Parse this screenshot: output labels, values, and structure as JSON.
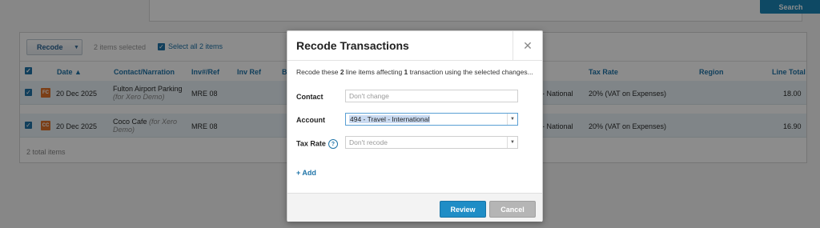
{
  "search": {
    "button_label": "Search"
  },
  "toolbar": {
    "recode_label": "Recode",
    "items_selected": "2 items selected",
    "select_all": "Select all 2 items"
  },
  "table": {
    "headers": {
      "date": "Date ▲",
      "contact": "Contact/Narration",
      "invref": "Inv#/Ref",
      "invref2": "Inv Ref",
      "b": "B",
      "taxrate": "Tax Rate",
      "region": "Region",
      "linetotal": "Line Total"
    },
    "rows": [
      {
        "badge": "FC",
        "badge_color": "#e0742b",
        "date": "20 Dec 2025",
        "contact": "Fulton Airport Parking",
        "note": "(for Xero Demo)",
        "ref": "MRE 08",
        "account_tail": "- National",
        "tax": "20% (VAT on Expenses)",
        "total": "18.00"
      },
      {
        "badge": "CC",
        "badge_color": "#e0742b",
        "date": "20 Dec 2025",
        "contact": "Coco Cafe",
        "note": "(for Xero Demo)",
        "ref": "MRE 08",
        "account_tail": "- National",
        "tax": "20% (VAT on Expenses)",
        "total": "16.90"
      }
    ],
    "total_items": "2 total items"
  },
  "modal": {
    "title": "Recode Transactions",
    "desc_pre": "Recode these ",
    "desc_n1": "2",
    "desc_mid": " line items affecting ",
    "desc_n2": "1",
    "desc_post": " transaction using the selected changes...",
    "contact_label": "Contact",
    "contact_placeholder": "Don't change",
    "account_label": "Account",
    "account_value": "494 - Travel - International",
    "taxrate_label": "Tax Rate",
    "taxrate_value": "Don't recode",
    "add_label": "+ Add",
    "review_label": "Review",
    "cancel_label": "Cancel"
  }
}
